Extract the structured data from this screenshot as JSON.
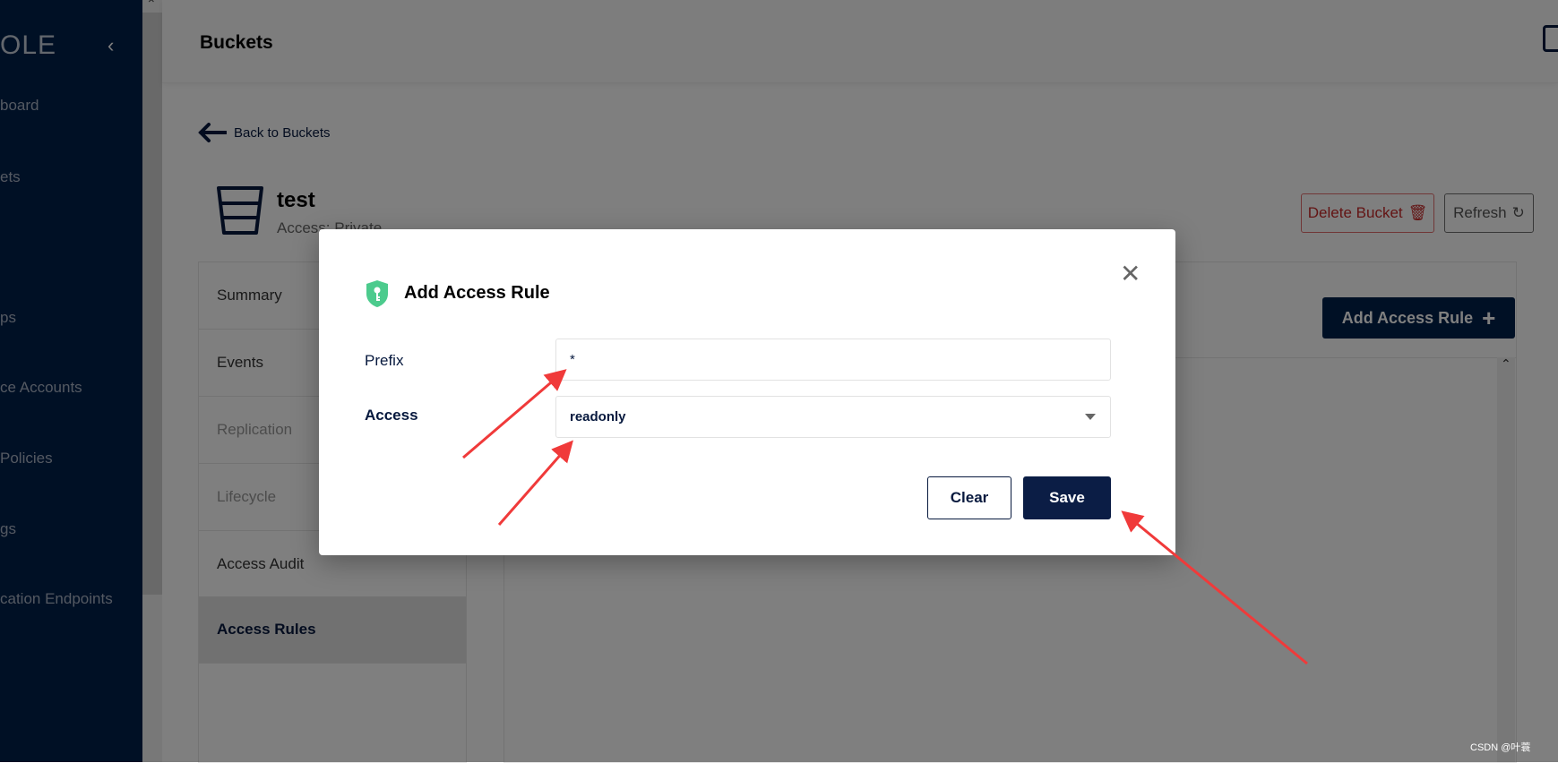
{
  "sidebar": {
    "logo": "OLE",
    "items": [
      "board",
      "ets",
      "ps",
      "ce Accounts",
      "Policies",
      "gs",
      "cation Endpoints"
    ]
  },
  "header": {
    "title": "Buckets"
  },
  "back_link": "Back to Buckets",
  "bucket": {
    "name": "test",
    "access": "Access: Private"
  },
  "actions": {
    "delete": "Delete Bucket",
    "refresh": "Refresh"
  },
  "tabs": [
    {
      "label": "Summary"
    },
    {
      "label": "Events"
    },
    {
      "label": "Replication",
      "disabled": true
    },
    {
      "label": "Lifecycle",
      "disabled": true
    },
    {
      "label": "Access Audit"
    },
    {
      "label": "Access Rules",
      "active": true
    }
  ],
  "content": {
    "add_button": "Add Access Rule"
  },
  "modal": {
    "title": "Add Access Rule",
    "prefix_label": "Prefix",
    "prefix_value": "*",
    "access_label": "Access",
    "access_value": "readonly",
    "clear": "Clear",
    "save": "Save"
  },
  "colors": {
    "brand": "#00204a",
    "accent_shield": "#4ccb8d",
    "danger": "#c62828",
    "annotation": "#f03a3a"
  },
  "watermark": "CSDN @叶蓑"
}
